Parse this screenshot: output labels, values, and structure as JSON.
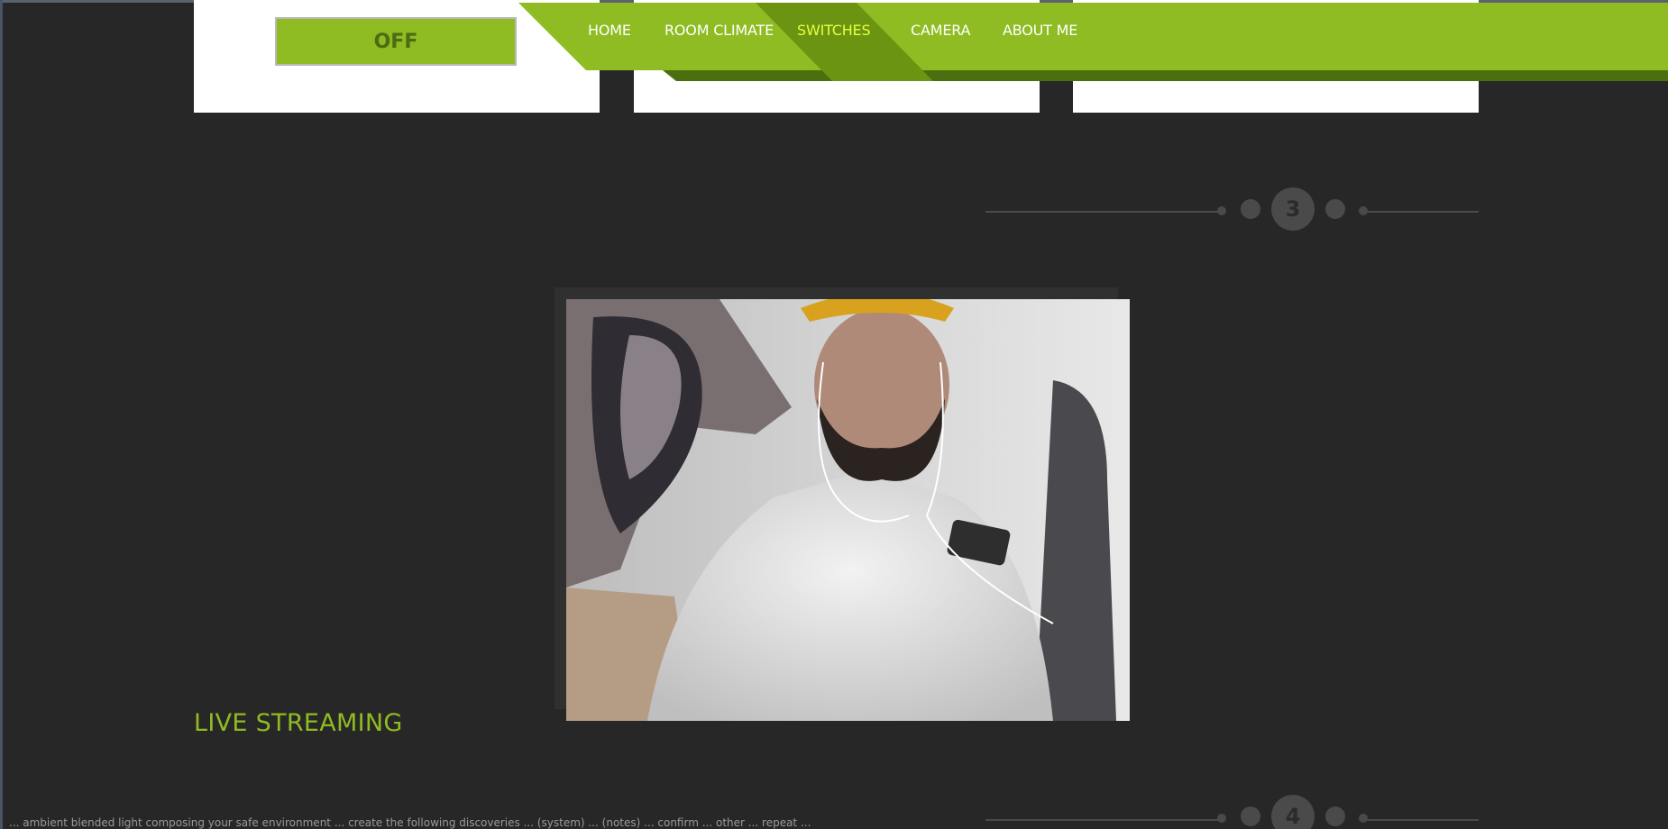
{
  "controls": {
    "off_label": "OFF"
  },
  "nav": {
    "items": [
      {
        "label": "HOME"
      },
      {
        "label": "ROOM CLIMATE"
      },
      {
        "label": "SWITCHES",
        "active": true
      },
      {
        "label": "CAMERA"
      },
      {
        "label": "ABOUT ME"
      }
    ]
  },
  "pagination": {
    "current": "3",
    "next": "4"
  },
  "section": {
    "title": "LIVE STREAMING"
  },
  "footer_text": "... ambient blended light composing your safe environment ... create the following discoveries ... (system) ... (notes) ... confirm ... other ... repeat ...",
  "colors": {
    "background": "#272727",
    "accent": "#8fbc22",
    "accent_dark": "#6a9412",
    "accent_darker": "#4b6e0e",
    "active_nav": "#e6ff3c"
  },
  "icons": [
    "camera-feed-image"
  ]
}
